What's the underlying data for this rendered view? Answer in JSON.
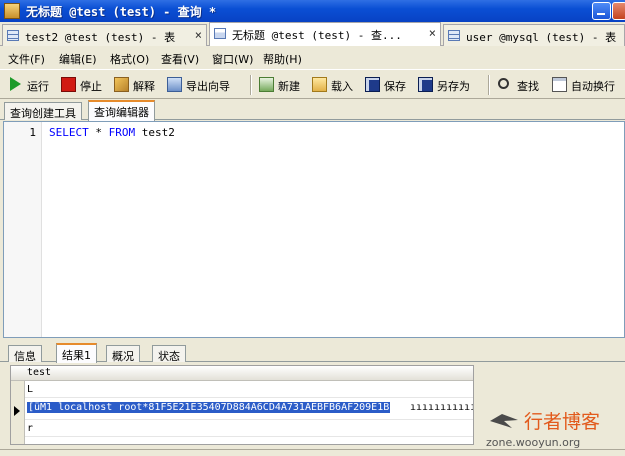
{
  "window": {
    "title": "无标题 @test (test) - 查询 *"
  },
  "doc_tabs": [
    {
      "label": "test2 @test (test) - 表",
      "close": "×"
    },
    {
      "label": "无标题 @test (test) - 查...",
      "close": "×"
    },
    {
      "label": "user @mysql (test) - 表",
      "close": ""
    }
  ],
  "menu": [
    "文件(F)",
    "编辑(E)",
    "格式(O)",
    "查看(V)",
    "窗口(W)",
    "帮助(H)"
  ],
  "toolbar": {
    "run": "运行",
    "stop": "停止",
    "explain": "解释",
    "export": "导出向导",
    "new": "新建",
    "load": "载入",
    "save": "保存",
    "save_as": "另存为",
    "find": "查找",
    "word_wrap": "自动换行"
  },
  "editor_tabs": [
    "查询创建工具",
    "查询编辑器"
  ],
  "editor": {
    "line_number": "1",
    "code_kw1": "SELECT",
    "code_mid": " * ",
    "code_kw2": "FROM",
    "code_rest": " test2"
  },
  "result_tabs": [
    "信息",
    "结果1",
    "概况",
    "状态"
  ],
  "grid": {
    "column": "test",
    "rows": [
      "L",
      "[üM1    localhost root*81F5E21E35407D884A6CD4A731AEBFB6AF209E1B",
      "r"
    ],
    "row2_tail": "ııııııııııı"
  },
  "watermark": {
    "text": "行者博客",
    "domain": "zone.wooyun.org"
  }
}
